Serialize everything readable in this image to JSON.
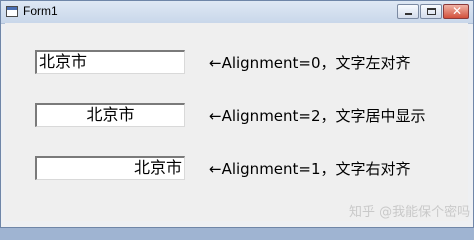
{
  "window": {
    "title": "Form1"
  },
  "rows": [
    {
      "textbox_value": "北京市",
      "alignment": "left",
      "note": "←Alignment=0，文字左对齐"
    },
    {
      "textbox_value": "北京市",
      "alignment": "center",
      "note": "←Alignment=2，文字居中显示"
    },
    {
      "textbox_value": "北京市",
      "alignment": "right",
      "note": "←Alignment=1，文字右对齐"
    }
  ],
  "watermark": "知乎 @我能保个密吗"
}
